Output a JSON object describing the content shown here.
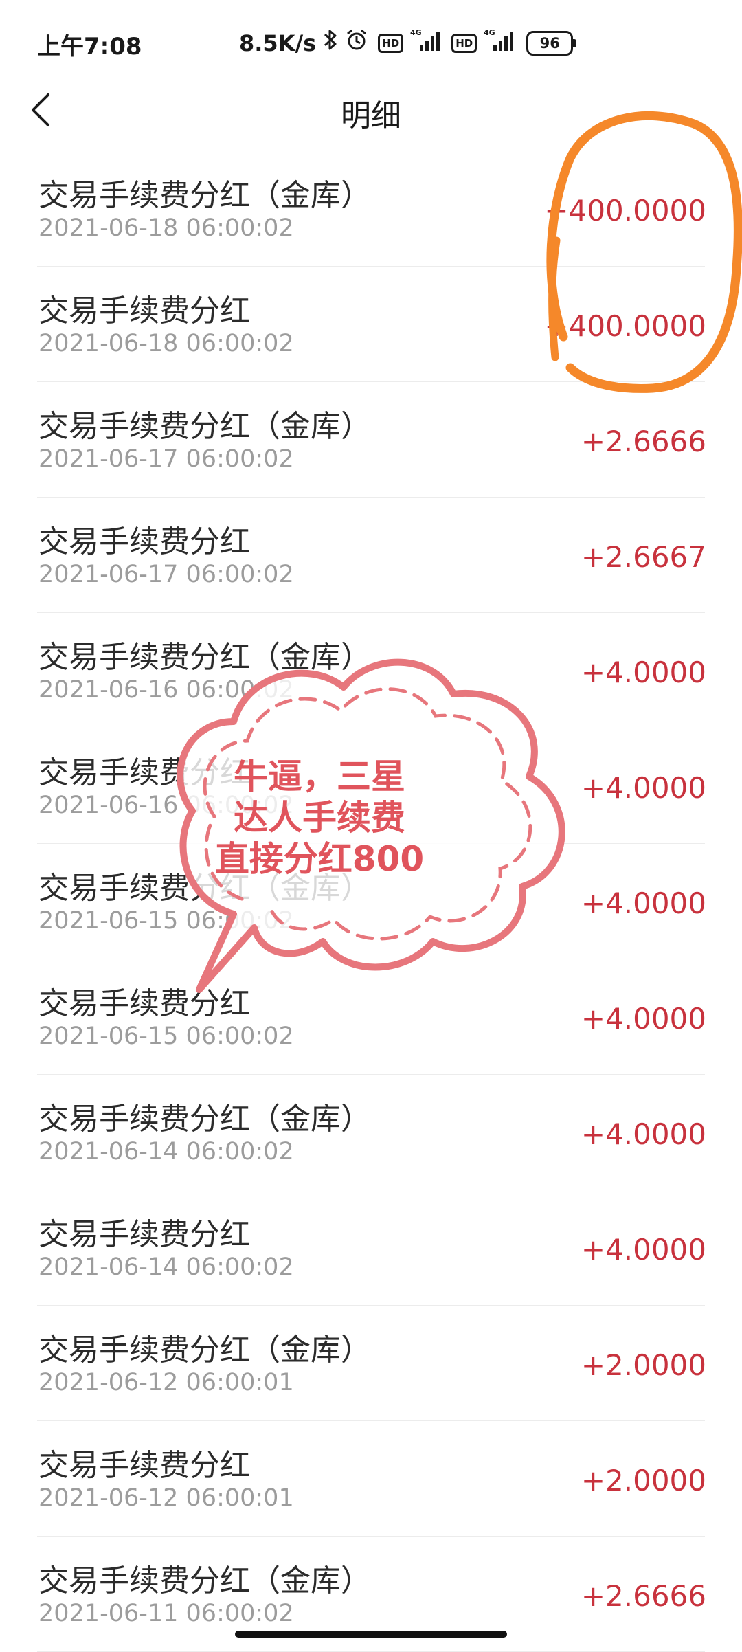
{
  "status_bar": {
    "time": "上午7:08",
    "net_speed": "8.5K/s",
    "icons": [
      "bluetooth-icon",
      "alarm-icon",
      "hd-badge",
      "signal-4g-icon",
      "hd-badge",
      "signal-4g-icon"
    ],
    "hd_label": "HD",
    "network_label": "4G",
    "battery": "96"
  },
  "header": {
    "back_icon": "chevron-left-icon",
    "title": "明细"
  },
  "transactions": [
    {
      "title": "交易手续费分红（金库）",
      "time": "2021-06-18 06:00:02",
      "amount": "+400.0000"
    },
    {
      "title": "交易手续费分红",
      "time": "2021-06-18 06:00:02",
      "amount": "+400.0000"
    },
    {
      "title": "交易手续费分红（金库）",
      "time": "2021-06-17 06:00:02",
      "amount": "+2.6666"
    },
    {
      "title": "交易手续费分红",
      "time": "2021-06-17 06:00:02",
      "amount": "+2.6667"
    },
    {
      "title": "交易手续费分红（金库）",
      "time": "2021-06-16 06:00:02",
      "amount": "+4.0000"
    },
    {
      "title": "交易手续费分红",
      "time": "2021-06-16 06:00:02",
      "amount": "+4.0000"
    },
    {
      "title": "交易手续费分红（金库）",
      "time": "2021-06-15 06:00:02",
      "amount": "+4.0000"
    },
    {
      "title": "交易手续费分红",
      "time": "2021-06-15 06:00:02",
      "amount": "+4.0000"
    },
    {
      "title": "交易手续费分红（金库）",
      "time": "2021-06-14 06:00:02",
      "amount": "+4.0000"
    },
    {
      "title": "交易手续费分红",
      "time": "2021-06-14 06:00:02",
      "amount": "+4.0000"
    },
    {
      "title": "交易手续费分红（金库）",
      "time": "2021-06-12 06:00:01",
      "amount": "+2.0000"
    },
    {
      "title": "交易手续费分红",
      "time": "2021-06-12 06:00:01",
      "amount": "+2.0000"
    },
    {
      "title": "交易手续费分红（金库）",
      "time": "2021-06-11 06:00:02",
      "amount": "+2.6666"
    }
  ],
  "annotation": {
    "sticker_lines": [
      "牛逼，三星",
      "达人手续费",
      "直接分红800"
    ],
    "sticker_color": "#e0545c",
    "highlight_color": "#f5882a"
  },
  "colors": {
    "amount": "#c8323d",
    "time": "#9c9c9c",
    "title": "#2b2b2b"
  }
}
